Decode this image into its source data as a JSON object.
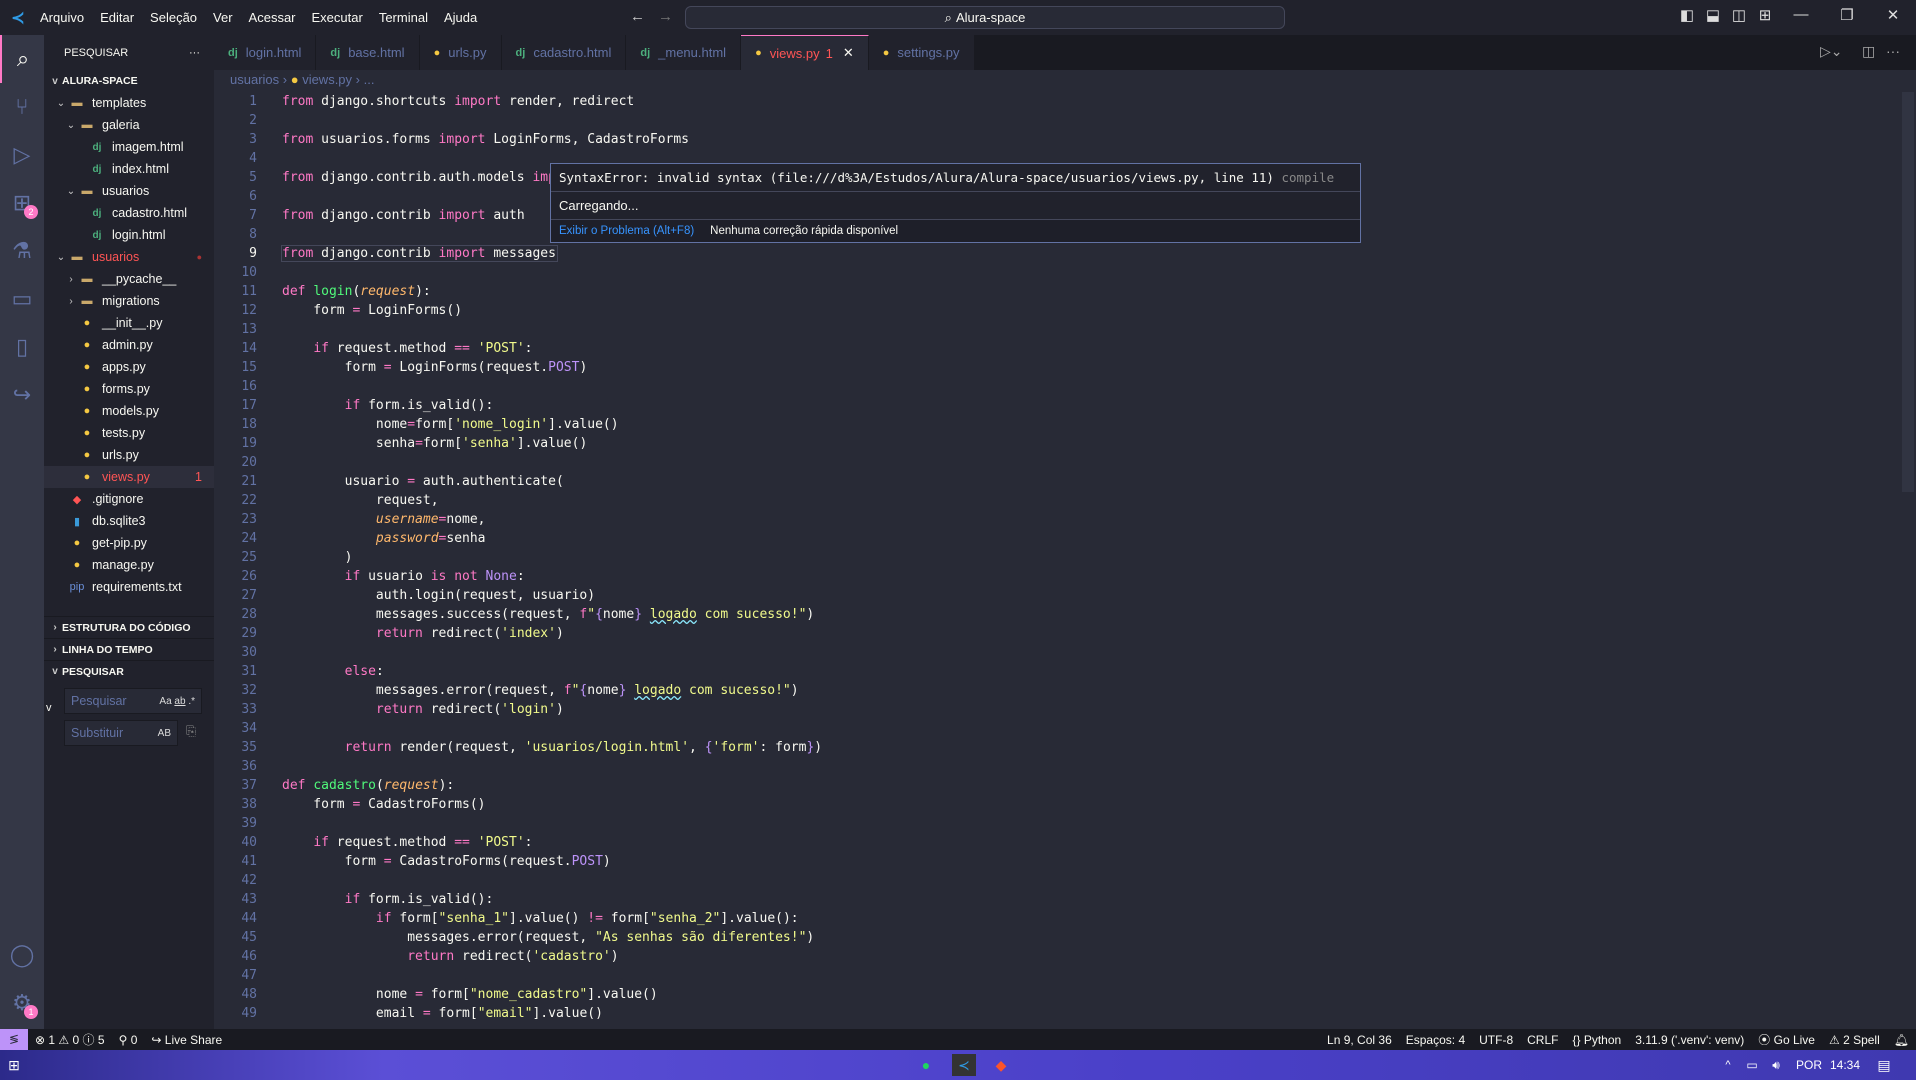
{
  "titlebar": {
    "menus": [
      "Arquivo",
      "Editar",
      "Seleção",
      "Ver",
      "Acessar",
      "Executar",
      "Terminal",
      "Ajuda"
    ],
    "search": "Alura-space"
  },
  "activity": {
    "extensions_badge": "2",
    "settings_badge": "1"
  },
  "sidebar": {
    "header": "PESQUISAR",
    "more": "···",
    "root": "ALURA-SPACE",
    "tree": [
      {
        "label": "templates",
        "indent": 1,
        "type": "folder",
        "chev": "v"
      },
      {
        "label": "galeria",
        "indent": 2,
        "type": "folder",
        "chev": "v"
      },
      {
        "label": "imagem.html",
        "indent": 3,
        "type": "dj"
      },
      {
        "label": "index.html",
        "indent": 3,
        "type": "dj"
      },
      {
        "label": "usuarios",
        "indent": 2,
        "type": "folder",
        "chev": "v"
      },
      {
        "label": "cadastro.html",
        "indent": 3,
        "type": "dj"
      },
      {
        "label": "login.html",
        "indent": 3,
        "type": "dj"
      },
      {
        "label": "usuarios",
        "indent": 1,
        "type": "folder",
        "chev": "v",
        "error": true,
        "dot": true
      },
      {
        "label": "__pycache__",
        "indent": 2,
        "type": "folder",
        "chev": ">"
      },
      {
        "label": "migrations",
        "indent": 2,
        "type": "folder",
        "chev": ">"
      },
      {
        "label": "__init__.py",
        "indent": 2,
        "type": "py"
      },
      {
        "label": "admin.py",
        "indent": 2,
        "type": "py"
      },
      {
        "label": "apps.py",
        "indent": 2,
        "type": "py"
      },
      {
        "label": "forms.py",
        "indent": 2,
        "type": "py"
      },
      {
        "label": "models.py",
        "indent": 2,
        "type": "py"
      },
      {
        "label": "tests.py",
        "indent": 2,
        "type": "py"
      },
      {
        "label": "urls.py",
        "indent": 2,
        "type": "py"
      },
      {
        "label": "views.py",
        "indent": 2,
        "type": "py",
        "error": true,
        "count": "1",
        "selected": true
      },
      {
        "label": ".gitignore",
        "indent": 1,
        "type": "git"
      },
      {
        "label": "db.sqlite3",
        "indent": 1,
        "type": "db"
      },
      {
        "label": "get-pip.py",
        "indent": 1,
        "type": "py"
      },
      {
        "label": "manage.py",
        "indent": 1,
        "type": "py"
      },
      {
        "label": "requirements.txt",
        "indent": 1,
        "type": "pip"
      }
    ],
    "sections": [
      "ESTRUTURA DO CÓDIGO",
      "LINHA DO TEMPO",
      "PESQUISAR"
    ],
    "search_placeholder": "Pesquisar",
    "replace_placeholder": "Substituir",
    "opt_case": "Aa",
    "opt_word": "ab",
    "opt_regex": ".*",
    "opt_preserve": "AB"
  },
  "tabs": [
    {
      "label": "login.html",
      "type": "dj"
    },
    {
      "label": "base.html",
      "type": "dj"
    },
    {
      "label": "urls.py",
      "type": "py"
    },
    {
      "label": "cadastro.html",
      "type": "dj"
    },
    {
      "label": "_menu.html",
      "type": "dj"
    },
    {
      "label": "views.py",
      "type": "py",
      "active": true,
      "count": "1"
    },
    {
      "label": "settings.py",
      "type": "py"
    }
  ],
  "breadcrumb": [
    "usuarios",
    "views.py",
    "..."
  ],
  "code": [
    [
      [
        "k",
        "from"
      ],
      [
        "t",
        " django.shortcuts "
      ],
      [
        "k",
        "import"
      ],
      [
        "t",
        " render, redirect"
      ]
    ],
    [],
    [
      [
        "k",
        "from"
      ],
      [
        "t",
        " usuarios.forms "
      ],
      [
        "k",
        "import"
      ],
      [
        "t",
        " LoginForms, CadastroForms"
      ]
    ],
    [],
    [
      [
        "k",
        "from"
      ],
      [
        "t",
        " django.contrib.auth.models "
      ],
      [
        "k",
        "imp"
      ]
    ],
    [],
    [
      [
        "k",
        "from"
      ],
      [
        "t",
        " django.contrib "
      ],
      [
        "k",
        "import"
      ],
      [
        "t",
        " auth"
      ]
    ],
    [],
    [
      [
        "k",
        "from"
      ],
      [
        "t",
        " django.contrib "
      ],
      [
        "k",
        "import"
      ],
      [
        "t",
        " messages"
      ]
    ],
    [],
    [
      [
        "k",
        "def"
      ],
      [
        "t",
        " "
      ],
      [
        "f",
        "login"
      ],
      [
        "t",
        "("
      ],
      [
        "p",
        "request"
      ],
      [
        "t",
        "):"
      ]
    ],
    [
      [
        "t",
        "    form "
      ],
      [
        "k",
        "="
      ],
      [
        "t",
        " LoginForms()"
      ]
    ],
    [],
    [
      [
        "t",
        "    "
      ],
      [
        "k",
        "if"
      ],
      [
        "t",
        " request.method "
      ],
      [
        "k",
        "=="
      ],
      [
        "t",
        " "
      ],
      [
        "s",
        "'POST'"
      ],
      [
        "t",
        ":"
      ]
    ],
    [
      [
        "t",
        "        form "
      ],
      [
        "k",
        "="
      ],
      [
        "t",
        " LoginForms(request."
      ],
      [
        "c",
        "POST"
      ],
      [
        "t",
        ")"
      ]
    ],
    [],
    [
      [
        "t",
        "        "
      ],
      [
        "k",
        "if"
      ],
      [
        "t",
        " form.is_valid():"
      ]
    ],
    [
      [
        "t",
        "            nome"
      ],
      [
        "k",
        "="
      ],
      [
        "t",
        "form["
      ],
      [
        "s",
        "'nome_login'"
      ],
      [
        "t",
        "].value()"
      ]
    ],
    [
      [
        "t",
        "            senha"
      ],
      [
        "k",
        "="
      ],
      [
        "t",
        "form["
      ],
      [
        "s",
        "'senha'"
      ],
      [
        "t",
        "].value()"
      ]
    ],
    [],
    [
      [
        "t",
        "        usuario "
      ],
      [
        "k",
        "="
      ],
      [
        "t",
        " auth.authenticate("
      ]
    ],
    [
      [
        "t",
        "            request,"
      ]
    ],
    [
      [
        "t",
        "            "
      ],
      [
        "p",
        "username"
      ],
      [
        "k",
        "="
      ],
      [
        "t",
        "nome,"
      ]
    ],
    [
      [
        "t",
        "            "
      ],
      [
        "p",
        "password"
      ],
      [
        "k",
        "="
      ],
      [
        "t",
        "senha"
      ]
    ],
    [
      [
        "t",
        "        )"
      ]
    ],
    [
      [
        "t",
        "        "
      ],
      [
        "k",
        "if"
      ],
      [
        "t",
        " usuario "
      ],
      [
        "k",
        "is not"
      ],
      [
        "t",
        " "
      ],
      [
        "c",
        "None"
      ],
      [
        "t",
        ":"
      ]
    ],
    [
      [
        "t",
        "            auth.login(request, usuario)"
      ]
    ],
    [
      [
        "t",
        "            messages.success(request, "
      ],
      [
        "k",
        "f"
      ],
      [
        "s",
        "\""
      ],
      [
        "c",
        "{"
      ],
      [
        "t",
        "nome"
      ],
      [
        "c",
        "}"
      ],
      [
        "s",
        " "
      ],
      [
        "sq",
        "logado"
      ],
      [
        "s",
        " com sucesso!\""
      ],
      [
        "t",
        ")"
      ]
    ],
    [
      [
        "t",
        "            "
      ],
      [
        "k",
        "return"
      ],
      [
        "t",
        " redirect("
      ],
      [
        "s",
        "'index'"
      ],
      [
        "t",
        ")"
      ]
    ],
    [],
    [
      [
        "t",
        "        "
      ],
      [
        "k",
        "else"
      ],
      [
        "t",
        ":"
      ]
    ],
    [
      [
        "t",
        "            messages.error(request, "
      ],
      [
        "k",
        "f"
      ],
      [
        "s",
        "\""
      ],
      [
        "c",
        "{"
      ],
      [
        "t",
        "nome"
      ],
      [
        "c",
        "}"
      ],
      [
        "s",
        " "
      ],
      [
        "sq",
        "logado"
      ],
      [
        "s",
        " com sucesso!\""
      ],
      [
        "t",
        ")"
      ]
    ],
    [
      [
        "t",
        "            "
      ],
      [
        "k",
        "return"
      ],
      [
        "t",
        " redirect("
      ],
      [
        "s",
        "'login'"
      ],
      [
        "t",
        ")"
      ]
    ],
    [],
    [
      [
        "t",
        "        "
      ],
      [
        "k",
        "return"
      ],
      [
        "t",
        " render(request, "
      ],
      [
        "s",
        "'usuarios/login.html'"
      ],
      [
        "t",
        ", "
      ],
      [
        "c",
        "{"
      ],
      [
        "s",
        "'form'"
      ],
      [
        "t",
        ": form"
      ],
      [
        "c",
        "}"
      ],
      [
        "t",
        ")"
      ]
    ],
    [],
    [
      [
        "k",
        "def"
      ],
      [
        "t",
        " "
      ],
      [
        "f",
        "cadastro"
      ],
      [
        "t",
        "("
      ],
      [
        "p",
        "request"
      ],
      [
        "t",
        "):"
      ]
    ],
    [
      [
        "t",
        "    form "
      ],
      [
        "k",
        "="
      ],
      [
        "t",
        " CadastroForms()"
      ]
    ],
    [],
    [
      [
        "t",
        "    "
      ],
      [
        "k",
        "if"
      ],
      [
        "t",
        " request.method "
      ],
      [
        "k",
        "=="
      ],
      [
        "t",
        " "
      ],
      [
        "s",
        "'POST'"
      ],
      [
        "t",
        ":"
      ]
    ],
    [
      [
        "t",
        "        form "
      ],
      [
        "k",
        "="
      ],
      [
        "t",
        " CadastroForms(request."
      ],
      [
        "c",
        "POST"
      ],
      [
        "t",
        ")"
      ]
    ],
    [],
    [
      [
        "t",
        "        "
      ],
      [
        "k",
        "if"
      ],
      [
        "t",
        " form.is_valid():"
      ]
    ],
    [
      [
        "t",
        "            "
      ],
      [
        "k",
        "if"
      ],
      [
        "t",
        " form["
      ],
      [
        "s",
        "\"senha_1\""
      ],
      [
        "t",
        "].value() "
      ],
      [
        "k",
        "!="
      ],
      [
        "t",
        " form["
      ],
      [
        "s",
        "\"senha_2\""
      ],
      [
        "t",
        "].value():"
      ]
    ],
    [
      [
        "t",
        "                messages.error(request, "
      ],
      [
        "s",
        "\"As senhas são diferentes!\""
      ],
      [
        "t",
        ")"
      ]
    ],
    [
      [
        "t",
        "                "
      ],
      [
        "k",
        "return"
      ],
      [
        "t",
        " redirect("
      ],
      [
        "s",
        "'cadastro'"
      ],
      [
        "t",
        ")"
      ]
    ],
    [],
    [
      [
        "t",
        "            nome "
      ],
      [
        "k",
        "="
      ],
      [
        "t",
        " form["
      ],
      [
        "s",
        "\"nome_cadastro\""
      ],
      [
        "t",
        "].value()"
      ]
    ],
    [
      [
        "t",
        "            email "
      ],
      [
        "k",
        "="
      ],
      [
        "t",
        " form["
      ],
      [
        "s",
        "\"email\""
      ],
      [
        "t",
        "].value()"
      ]
    ]
  ],
  "current_line": 9,
  "hover": {
    "message": "SyntaxError: invalid syntax (file:///d%3A/Estudos/Alura/Alura-space/usuarios/views.py, line 11)",
    "source": "compile",
    "loading": "Carregando...",
    "view_problem": "Exibir o Problema (Alt+F8)",
    "no_fix": "Nenhuma correção rápida disponível"
  },
  "status": {
    "errors": "1",
    "warnings": "0",
    "info": "5",
    "ports": "0",
    "live_share": "Live Share",
    "position": "Ln 9, Col 36",
    "spaces": "Espaços: 4",
    "encoding": "UTF-8",
    "eol": "CRLF",
    "language": "Python",
    "interpreter": "3.11.9 ('.venv': venv)",
    "go_live": "Go Live",
    "spell": "2 Spell"
  },
  "taskbar": {
    "lang": "POR",
    "time": "14:34"
  },
  "colors": {
    "accent": "#bd93f9",
    "error": "#ff5555",
    "keyword": "#ff79c6"
  }
}
